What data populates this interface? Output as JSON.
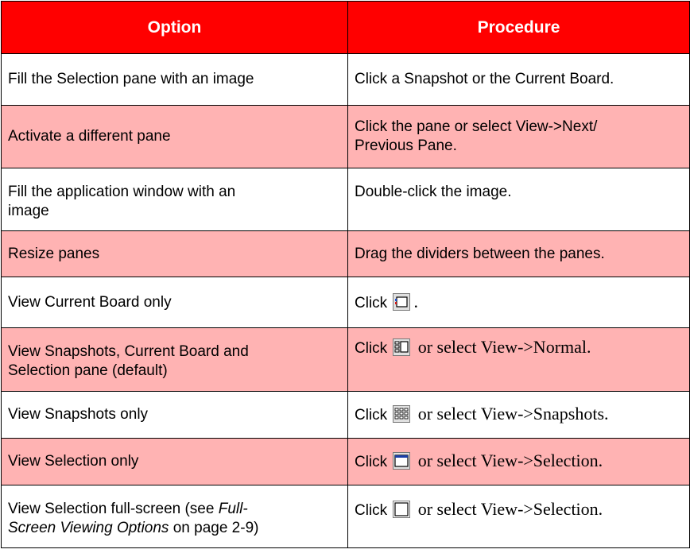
{
  "header": {
    "option": "Option",
    "procedure": "Procedure"
  },
  "rows": [
    {
      "option": "Fill the Selection pane with an image",
      "procedure": "Click a Snapshot or the Current Board.",
      "shaded": false
    },
    {
      "option": "Activate a different pane",
      "procedure_line1": "Click the pane or select View->Next/",
      "procedure_line2": "Previous Pane.",
      "shaded": true
    },
    {
      "option_line1": "Fill the application window with an",
      "option_line2": "image",
      "procedure": "Double-click the image.",
      "shaded": false
    },
    {
      "option": "Resize panes",
      "procedure": "Drag the dividers between the panes.",
      "shaded": true
    },
    {
      "option": "View Current Board only",
      "procedure_click": "Click",
      "procedure_tail": ".",
      "icon": "current-board-view-icon",
      "shaded": false
    },
    {
      "option_line1": "View Snapshots, Current Board and",
      "option_line2": "Selection pane (default)",
      "procedure_click": "Click",
      "procedure_tail": "or select View->Normal.",
      "icon": "normal-view-icon",
      "shaded": true
    },
    {
      "option": "View Snapshots only",
      "procedure_click": "Click",
      "procedure_tail": "or select View->Snapshots.",
      "icon": "snapshots-view-icon",
      "shaded": false
    },
    {
      "option": "View Selection only",
      "procedure_click": "Click",
      "procedure_tail": "or select View->Selection.",
      "icon": "selection-view-icon",
      "shaded": true
    },
    {
      "option_line1_a": "View Selection full-screen (see ",
      "option_line1_b": "Full-",
      "option_line2_a": "Screen Viewing Options",
      "option_line2_b": " on page 2-9)",
      "procedure_click": "Click",
      "procedure_tail": "or select View->Selection.",
      "icon": "fullscreen-view-icon",
      "shaded": false
    }
  ]
}
